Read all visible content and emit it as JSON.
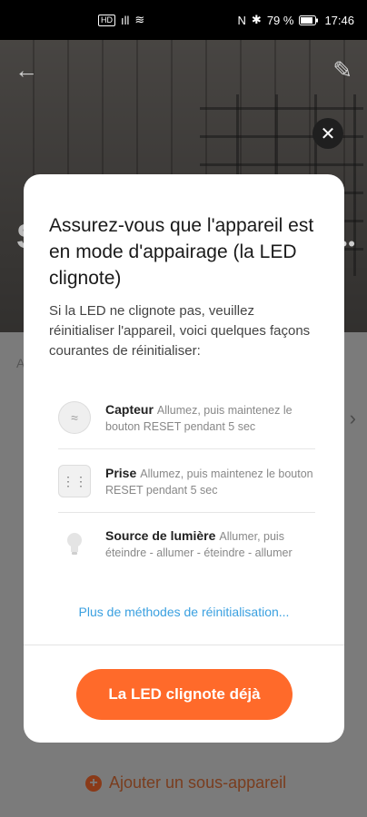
{
  "status_bar": {
    "left_chip": "HD",
    "signal": "ıll",
    "wifi": "≋",
    "nfc": "N",
    "bluetooth": "✱",
    "battery_percent": "79 %",
    "time": "17:46"
  },
  "background": {
    "add_sub_device_label": "Ajouter un sous-appareil",
    "letter_s": "S",
    "letter_a": "A"
  },
  "modal": {
    "title": "Assurez-vous que l'appareil est en mode d'appairage (la LED clignote)",
    "description": "Si la LED ne clignote pas, veuillez réinitialiser l'appareil, voici quelques façons courantes de réinitialiser:",
    "methods": [
      {
        "name": "Capteur",
        "instruction": "Allumez, puis maintenez le bouton RESET pendant 5 sec",
        "icon": "sensor-icon"
      },
      {
        "name": "Prise",
        "instruction": "Allumez, puis maintenez le bouton RESET pendant 5 sec",
        "icon": "plug-icon"
      },
      {
        "name": "Source de lumière",
        "instruction": "Allumer, puis éteindre - allumer - éteindre - allumer",
        "icon": "bulb-icon"
      }
    ],
    "more_link": "Plus de méthodes de réinitialisation...",
    "primary_button": "La LED clignote déjà"
  },
  "colors": {
    "accent": "#ff6a2a",
    "link": "#3aa0e0"
  }
}
